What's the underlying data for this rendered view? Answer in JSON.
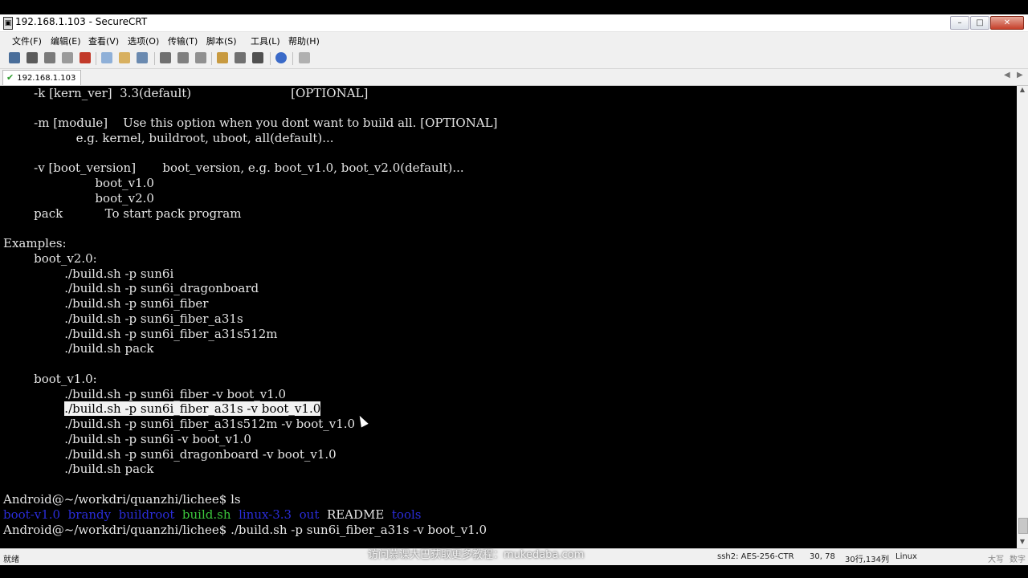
{
  "window": {
    "title": "192.168.1.103 - SecureCRT",
    "app_icon": "securecrt-app-icon",
    "controls": {
      "minimize": "–",
      "maximize": "□",
      "close": "✕"
    }
  },
  "menu": [
    "文件(F)",
    "编辑(E)",
    "查看(V)",
    "选项(O)",
    "传输(T)",
    "脚本(S)",
    "工具(L)",
    "帮助(H)"
  ],
  "toolbar": {
    "icons": [
      "connect-icon",
      "quick-connect-icon",
      "connect-in-tab-icon",
      "reconnect-icon",
      "disconnect-icon",
      "copy-icon",
      "paste-icon",
      "find-icon",
      "print-icon",
      "print-selection-icon",
      "print-setup-icon",
      "session-options-icon",
      "global-options-icon",
      "keymap-icon",
      "help-icon",
      "sftp-icon"
    ]
  },
  "tab": {
    "label": "192.168.1.103",
    "status_icon": "check-icon",
    "nav_left": "◀",
    "nav_right": "▶"
  },
  "terminal": {
    "lines": [
      "        -k [kern_ver]  3.3(default)                          [OPTIONAL]",
      "",
      "        -m [module]    Use this option when you dont want to build all. [OPTIONAL]",
      "                   e.g. kernel, buildroot, uboot, all(default)...",
      "",
      "        -v [boot_version]       boot_version, e.g. boot_v1.0, boot_v2.0(default)...",
      "                        boot_v1.0",
      "                        boot_v2.0",
      "        pack           To start pack program",
      "",
      "Examples:",
      "        boot_v2.0:",
      "                ./build.sh -p sun6i",
      "                ./build.sh -p sun6i_dragonboard",
      "                ./build.sh -p sun6i_fiber",
      "                ./build.sh -p sun6i_fiber_a31s",
      "                ./build.sh -p sun6i_fiber_a31s512m",
      "                ./build.sh pack",
      "",
      "        boot_v1.0:",
      "                ./build.sh -p sun6i_fiber -v boot_v1.0",
      "                ",
      "                ./build.sh -p sun6i_fiber_a31s512m -v boot_v1.0",
      "                ./build.sh -p sun6i -v boot_v1.0",
      "                ./build.sh -p sun6i_dragonboard -v boot_v1.0",
      "                ./build.sh pack",
      "",
      "Android@~/workdri/quanzhi/lichee$ ls",
      "",
      "Android@~/workdri/quanzhi/lichee$ ./build.sh -p sun6i_fiber_a31s -v boot_v1.0"
    ],
    "highlighted_text": "./build.sh -p sun6i_fiber_a31s -v boot_v1.0",
    "ls_output": [
      {
        "name": "boot-v1.0",
        "color": "#2a2cd8"
      },
      {
        "name": "brandy",
        "color": "#2a2cd8"
      },
      {
        "name": "buildroot",
        "color": "#2a2cd8"
      },
      {
        "name": "build.sh",
        "color": "#3cc83c"
      },
      {
        "name": "linux-3.3",
        "color": "#2a2cd8"
      },
      {
        "name": "out",
        "color": "#2a2cd8"
      },
      {
        "name": "README",
        "color": "#e6e6e6"
      },
      {
        "name": "tools",
        "color": "#2a2cd8"
      }
    ]
  },
  "statusbar": {
    "ready": "就绪",
    "cipher": "ssh2: AES-256-CTR",
    "cursor_pos": "30,  78",
    "size": "30行,134列",
    "os": "Linux",
    "caps": "大写",
    "num": "数字"
  },
  "watermark": "访问慕课大巴获取更多教程：mukedaba.com"
}
